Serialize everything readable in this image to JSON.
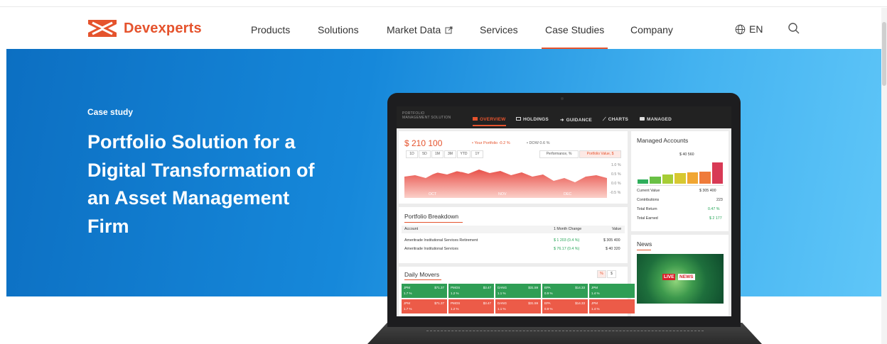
{
  "header": {
    "brand": "Devexperts",
    "nav": [
      "Products",
      "Solutions",
      "Market Data",
      "Services",
      "Case Studies",
      "Company"
    ],
    "active_nav": "Case Studies",
    "lang": "EN"
  },
  "hero": {
    "eyebrow": "Case study",
    "title": "Portfolio Solution for a Digital Transformation of an Asset Management Firm"
  },
  "app": {
    "brand_line1": "PORTFOLIO",
    "brand_line2": "MANAGEMENT SOLUTION",
    "tabs": [
      "OVERVIEW",
      "HOLDINGS",
      "GUIDANCE",
      "CHARTS",
      "MANAGED"
    ],
    "active_tab": "OVERVIEW",
    "overview": {
      "value": "$ 210 100",
      "legend_portfolio": "• Your Portfolio  -0.2 %",
      "legend_dow": "• DOW  0.6 %",
      "periods": [
        "1D",
        "5D",
        "1M",
        "3M",
        "YTD",
        "1Y"
      ],
      "toggle_performance": "Performance, %",
      "toggle_value": "Portfolio Value, $",
      "y_ticks": [
        "1.0 %",
        "0.5 %",
        "0.0 %",
        "-0.5 %"
      ],
      "x_ticks": [
        "OCT",
        "NOV",
        "DEC"
      ],
      "colors": {
        "area_top": "#e8514a",
        "area_bottom": "#fbd0c9",
        "line": "#ffffff"
      }
    },
    "managed": {
      "title": "Managed Accounts",
      "chart_value": "$ 40 560",
      "bar_levels": [
        0.16,
        0.28,
        0.36,
        0.42,
        0.44,
        0.46,
        0.84
      ],
      "bar_colors": [
        "#2fae5b",
        "#69c045",
        "#a7cd36",
        "#d7c831",
        "#f1a632",
        "#ef7b3a",
        "#d83a55"
      ],
      "rows": [
        {
          "label": "Current Value",
          "value": "$ 305 400"
        },
        {
          "label": "Contributions",
          "value": "223"
        },
        {
          "label": "Total Return",
          "value": "0.47 %"
        },
        {
          "label": "Total Earned",
          "value": "$ 2 177"
        }
      ]
    },
    "breakdown": {
      "title": "Portfolio Breakdown",
      "columns": [
        "Account",
        "1 Month Change",
        "Value"
      ],
      "rows": [
        {
          "account": "Ameritrade Institutional Services Retirement",
          "change": "$ 1 203 (0.4 %)",
          "value": "$ 305 400"
        },
        {
          "account": "Ameritrade Institutional Services",
          "change": "$ 76.17 (0.4 %)",
          "value": "$ 40 320"
        }
      ]
    },
    "news": {
      "title": "News",
      "badge_live": "LIVE",
      "badge_news": "NEWS"
    },
    "movers": {
      "title": "Daily Movers",
      "toggle_pct": "%",
      "toggle_dollar": "$",
      "up": [
        {
          "sym": "JPM",
          "price": "$71.37",
          "chg": "1.7 %"
        },
        {
          "sym": "PMOS",
          "price": "$3.47",
          "chg": "1.2 %"
        },
        {
          "sym": "DANG",
          "price": "$31.59",
          "chg": "1.1 %"
        },
        {
          "sym": "EPA",
          "price": "$14.33",
          "chg": "0.9 %"
        },
        {
          "sym": "JPM",
          "price": "",
          "chg": "1.4 %"
        }
      ],
      "down": [
        {
          "sym": "JPM",
          "price": "$71.37",
          "chg": "1.7 %"
        },
        {
          "sym": "PMOS",
          "price": "$3.47",
          "chg": "1.2 %"
        },
        {
          "sym": "DANG",
          "price": "$31.59",
          "chg": "1.1 %"
        },
        {
          "sym": "EPA",
          "price": "$14.33",
          "chg": "0.9 %"
        },
        {
          "sym": "JPM",
          "price": "",
          "chg": "1.4 %"
        }
      ],
      "colors": {
        "up": "#2f9e55",
        "down": "#ec5b48"
      }
    }
  }
}
